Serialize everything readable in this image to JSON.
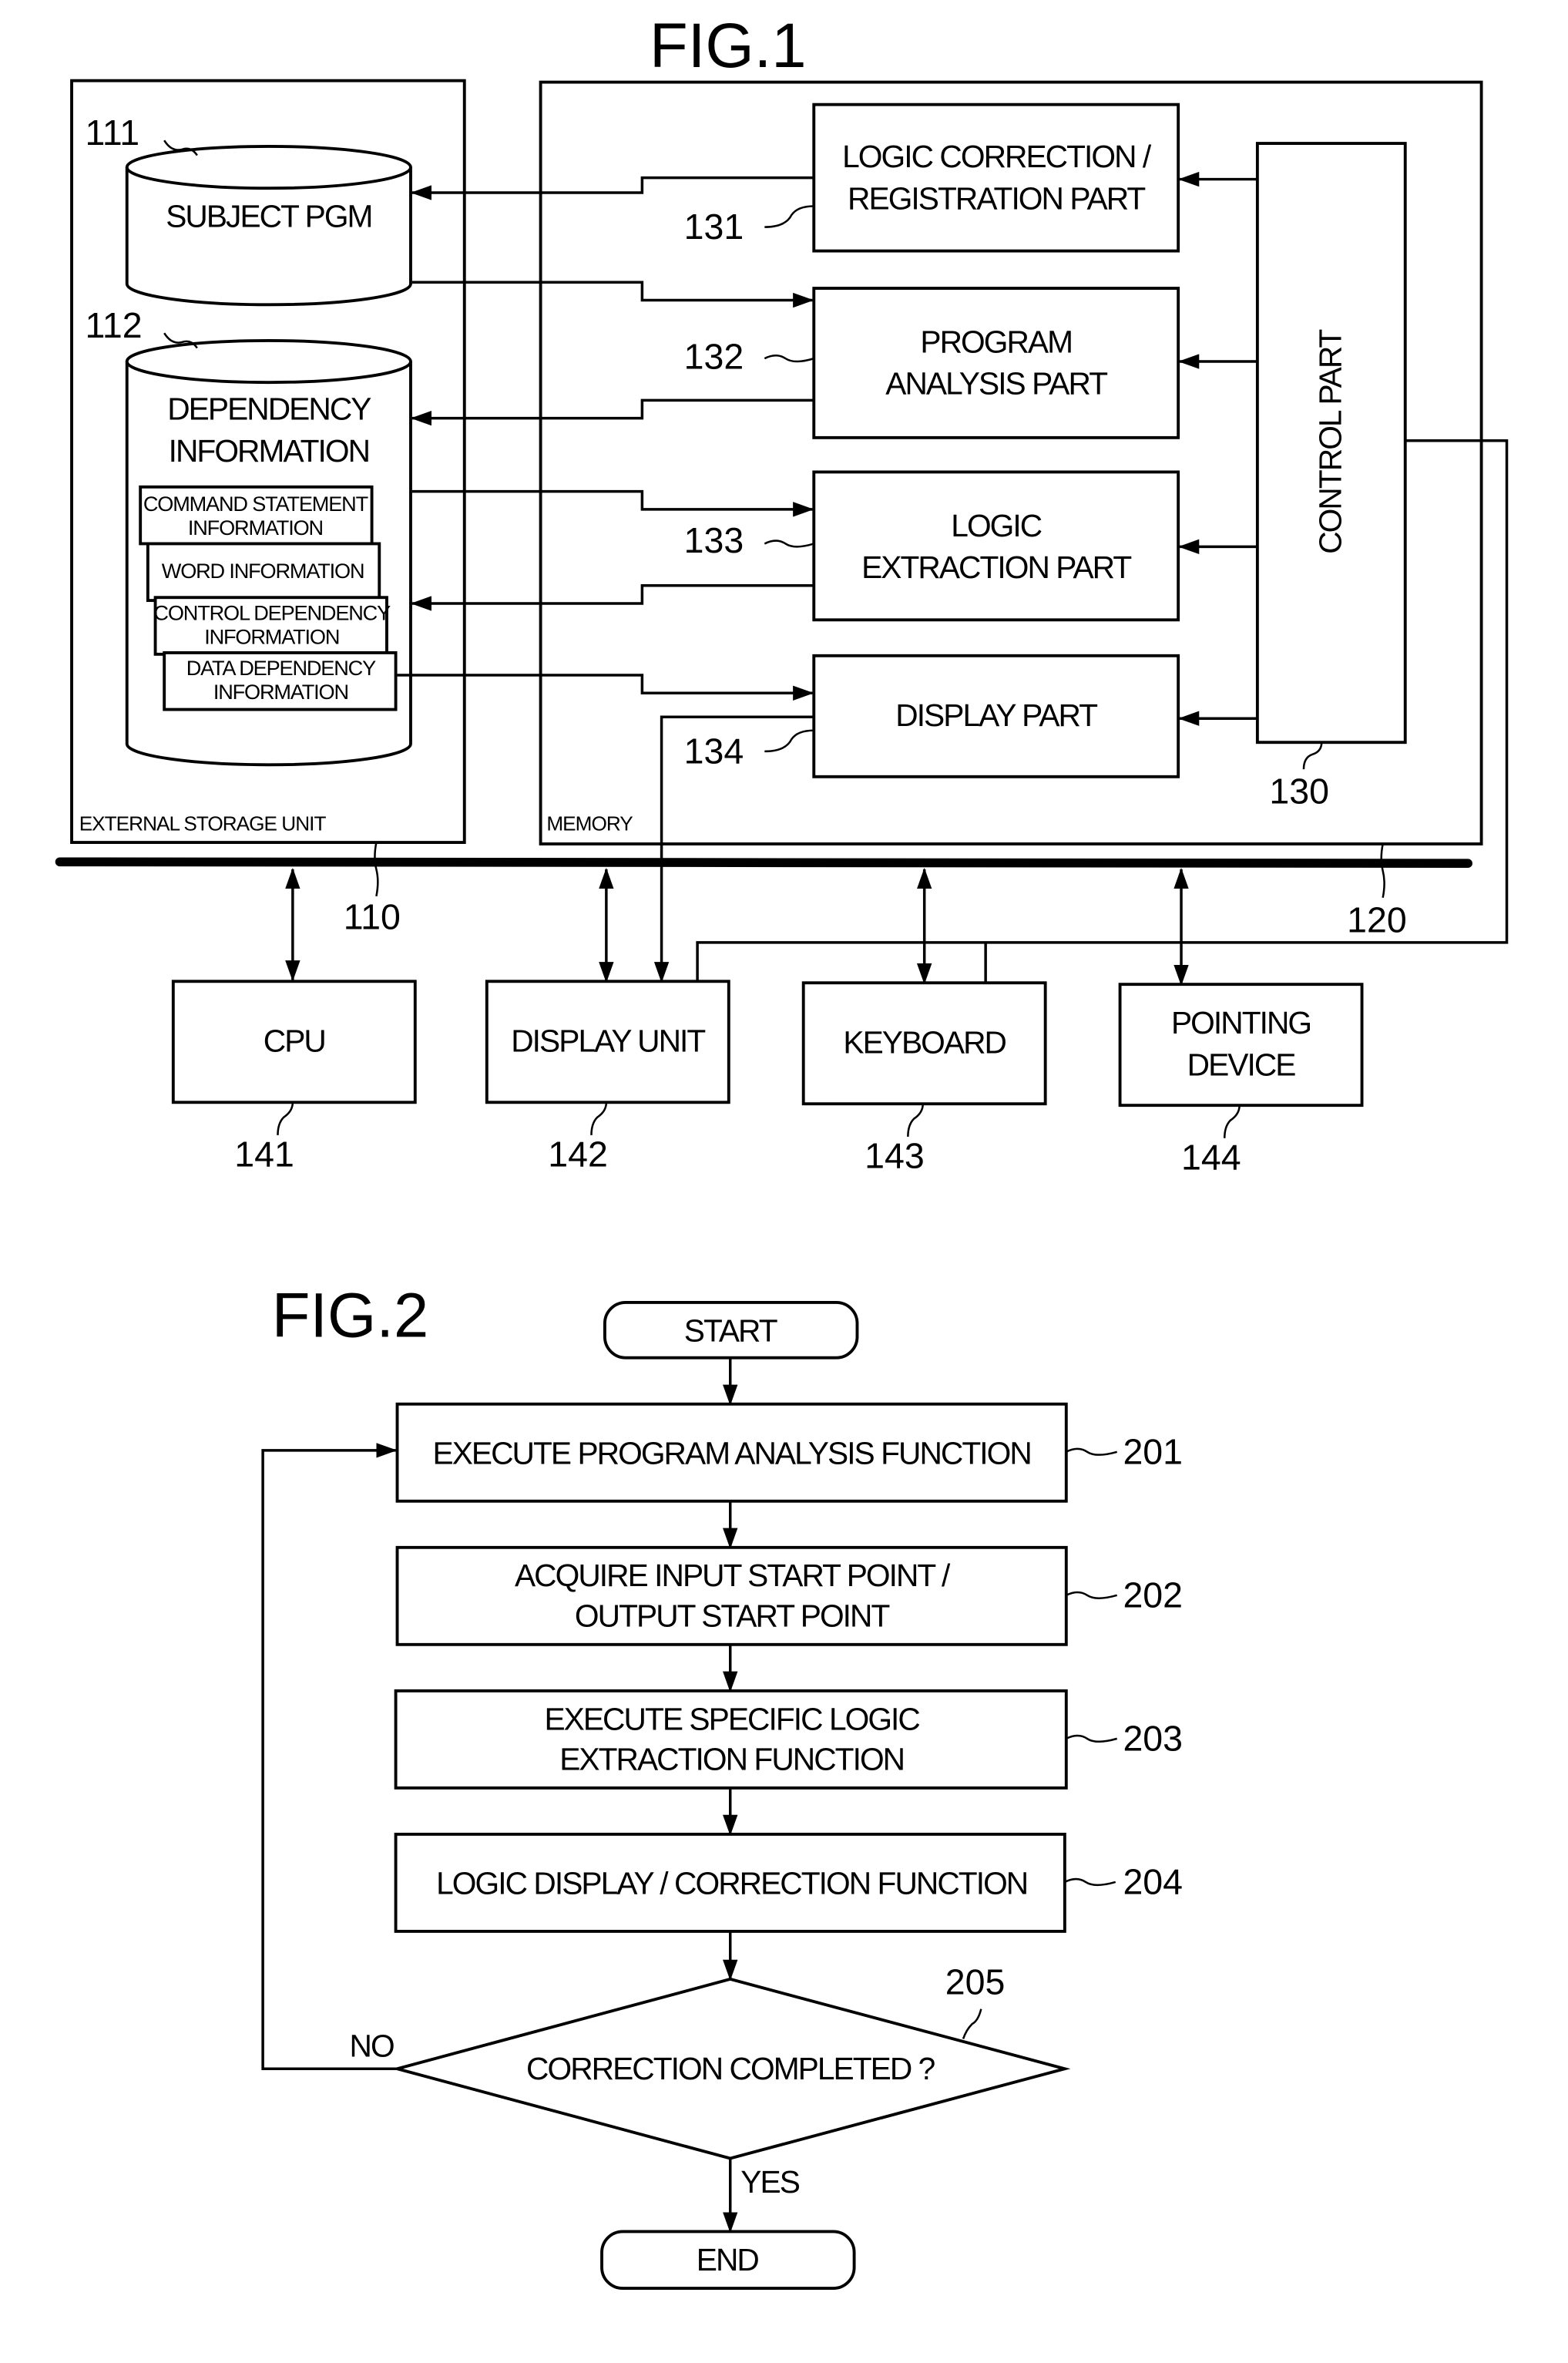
{
  "fig1": {
    "title": "FIG.1",
    "external_storage": {
      "caption": "EXTERNAL STORAGE UNIT",
      "ref": "110",
      "subject_pgm": {
        "ref": "111",
        "label": "SUBJECT PGM"
      },
      "dependency": {
        "ref": "112",
        "label_lines": [
          "DEPENDENCY",
          "INFORMATION"
        ],
        "sub_items": [
          {
            "lines": [
              "COMMAND STATEMENT",
              "INFORMATION"
            ]
          },
          {
            "lines": [
              "WORD INFORMATION"
            ]
          },
          {
            "lines": [
              "CONTROL DEPENDENCY",
              "INFORMATION"
            ]
          },
          {
            "lines": [
              "DATA DEPENDENCY",
              "INFORMATION"
            ]
          }
        ]
      }
    },
    "memory": {
      "caption": "MEMORY",
      "ref": "120",
      "parts": [
        {
          "ref": "131",
          "lines": [
            "LOGIC CORRECTION /",
            "REGISTRATION PART"
          ]
        },
        {
          "ref": "132",
          "lines": [
            "PROGRAM",
            "ANALYSIS PART"
          ]
        },
        {
          "ref": "133",
          "lines": [
            "LOGIC",
            "EXTRACTION PART"
          ]
        },
        {
          "ref": "134",
          "lines": [
            "DISPLAY PART"
          ]
        }
      ],
      "control_part": {
        "ref": "130",
        "label": "CONTROL PART"
      }
    },
    "devices": [
      {
        "ref": "141",
        "lines": [
          "CPU"
        ]
      },
      {
        "ref": "142",
        "lines": [
          "DISPLAY UNIT"
        ]
      },
      {
        "ref": "143",
        "lines": [
          "KEYBOARD"
        ]
      },
      {
        "ref": "144",
        "lines": [
          "POINTING",
          "DEVICE"
        ]
      }
    ]
  },
  "fig2": {
    "title": "FIG.2",
    "start": "START",
    "end": "END",
    "steps": [
      {
        "ref": "201",
        "lines": [
          "EXECUTE PROGRAM ANALYSIS FUNCTION"
        ]
      },
      {
        "ref": "202",
        "lines": [
          "ACQUIRE INPUT START POINT /",
          "OUTPUT START POINT"
        ]
      },
      {
        "ref": "203",
        "lines": [
          "EXECUTE SPECIFIC LOGIC",
          "EXTRACTION FUNCTION"
        ]
      },
      {
        "ref": "204",
        "lines": [
          "LOGIC DISPLAY / CORRECTION FUNCTION"
        ]
      }
    ],
    "decision": {
      "ref": "205",
      "label": "CORRECTION COMPLETED ?",
      "no_label": "NO",
      "yes_label": "YES"
    }
  }
}
